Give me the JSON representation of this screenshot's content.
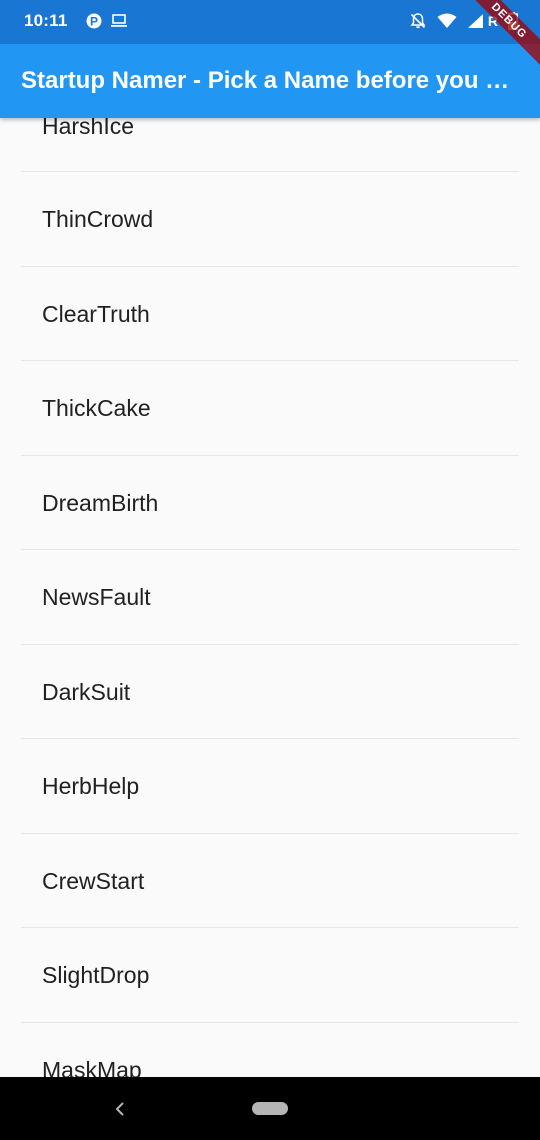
{
  "status_bar": {
    "time": "10:11",
    "left_icons": [
      "parking-icon",
      "laptop-icon"
    ],
    "right_icons": [
      "notifications-off-icon",
      "wifi-icon",
      "signal-icon",
      "battery-icon"
    ],
    "network_label": "R"
  },
  "app_bar": {
    "title": "Startup Namer - Pick a Name before you start"
  },
  "debug_banner": {
    "label": "DEBUG"
  },
  "list": {
    "items": [
      "HarshIce",
      "ThinCrowd",
      "ClearTruth",
      "ThickCake",
      "DreamBirth",
      "NewsFault",
      "DarkSuit",
      "HerbHelp",
      "CrewStart",
      "SlightDrop",
      "MaskMap"
    ]
  },
  "nav_bar": {
    "buttons": [
      "back-icon",
      "home-pill"
    ]
  },
  "colors": {
    "status_bar": "#1976d2",
    "app_bar": "#2196f3",
    "background": "#fafafa",
    "divider": "#e6e6e6",
    "text": "#212121",
    "debug_banner": "#a20000"
  }
}
